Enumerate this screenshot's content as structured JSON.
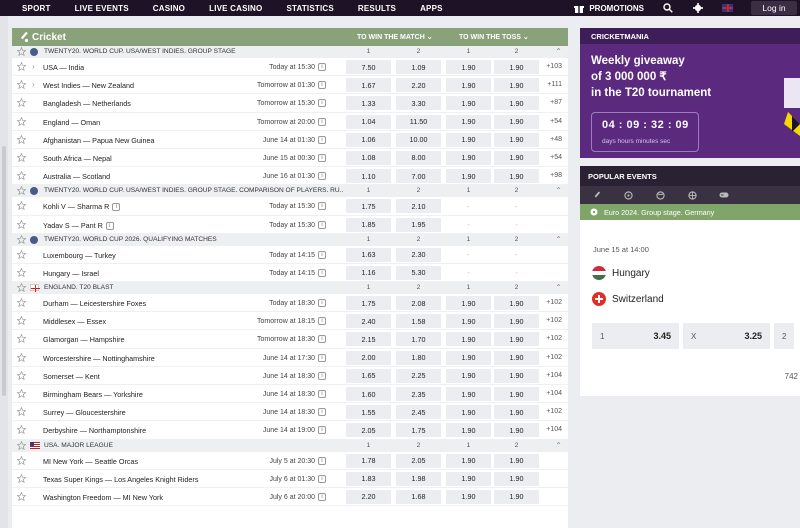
{
  "nav": {
    "items": [
      "SPORT",
      "LIVE EVENTS",
      "CASINO",
      "LIVE CASINO",
      "STATISTICS",
      "RESULTS",
      "APPS"
    ],
    "promotions": "PROMOTIONS",
    "login": "Log in"
  },
  "sport": {
    "title": "Cricket",
    "col_match": "TO WIN THE MATCH",
    "col_toss": "TO WIN THE TOSS"
  },
  "leagues": [
    {
      "name": "TWENTY20. WORLD CUP. USA/WEST INDIES. GROUP STAGE",
      "headers": [
        "1",
        "2",
        "1",
        "2"
      ],
      "rows": [
        {
          "teams": "USA — India",
          "time": "Today at 15:30",
          "odds": [
            "7.50",
            "1.09",
            "1.90",
            "1.90"
          ],
          "more": "+103",
          "chev": true
        },
        {
          "teams": "West Indies — New Zealand",
          "time": "Tomorrow at 01:30",
          "odds": [
            "1.67",
            "2.20",
            "1.90",
            "1.90"
          ],
          "more": "+111",
          "chev": true
        },
        {
          "teams": "Bangladesh — Netherlands",
          "time": "Tomorrow at 15:30",
          "odds": [
            "1.33",
            "3.30",
            "1.90",
            "1.90"
          ],
          "more": "+87"
        },
        {
          "teams": "England — Oman",
          "time": "Tomorrow at 20:00",
          "odds": [
            "1.04",
            "11.50",
            "1.90",
            "1.90"
          ],
          "more": "+54"
        },
        {
          "teams": "Afghanistan — Papua New Guinea",
          "time": "June 14 at 01:30",
          "odds": [
            "1.06",
            "10.00",
            "1.90",
            "1.90"
          ],
          "more": "+48"
        },
        {
          "teams": "South Africa — Nepal",
          "time": "June 15 at 00:30",
          "odds": [
            "1.08",
            "8.00",
            "1.90",
            "1.90"
          ],
          "more": "+54"
        },
        {
          "teams": "Australia — Scotland",
          "time": "June 16 at 01:30",
          "odds": [
            "1.10",
            "7.00",
            "1.90",
            "1.90"
          ],
          "more": "+98"
        }
      ]
    },
    {
      "name": "TWENTY20. WORLD CUP. USA/WEST INDIES. GROUP STAGE. COMPARISON OF PLAYERS. RU...",
      "headers": [
        "1",
        "2",
        "1",
        "2"
      ],
      "rows": [
        {
          "teams": "Kohli V — Sharma R",
          "time": "Today at 15:30",
          "odds": [
            "1.75",
            "2.10",
            "-",
            "-"
          ],
          "more": "",
          "info": true
        },
        {
          "teams": "Yadav S — Pant R",
          "time": "Today at 15:30",
          "odds": [
            "1.85",
            "1.95",
            "-",
            "-"
          ],
          "more": "",
          "info": true
        }
      ]
    },
    {
      "name": "TWENTY20. WORLD CUP 2026. QUALIFYING MATCHES",
      "headers": [
        "1",
        "2",
        "1",
        "2"
      ],
      "rows": [
        {
          "teams": "Luxembourg — Turkey",
          "time": "Today at 14:15",
          "odds": [
            "1.63",
            "2.30",
            "-",
            "-"
          ],
          "more": ""
        },
        {
          "teams": "Hungary — Israel",
          "time": "Today at 14:15",
          "odds": [
            "1.16",
            "5.30",
            "-",
            "-"
          ],
          "more": ""
        }
      ]
    },
    {
      "name": "ENGLAND. T20 BLAST",
      "headers": [
        "1",
        "2",
        "1",
        "2"
      ],
      "rows": [
        {
          "teams": "Durham — Leicestershire Foxes",
          "time": "Today at 18:30",
          "odds": [
            "1.75",
            "2.08",
            "1.90",
            "1.90"
          ],
          "more": "+102"
        },
        {
          "teams": "Middlesex — Essex",
          "time": "Tomorrow at 18:15",
          "odds": [
            "2.40",
            "1.58",
            "1.90",
            "1.90"
          ],
          "more": "+102"
        },
        {
          "teams": "Glamorgan — Hampshire",
          "time": "Tomorrow at 18:30",
          "odds": [
            "2.15",
            "1.70",
            "1.90",
            "1.90"
          ],
          "more": "+102"
        },
        {
          "teams": "Worcestershire — Nottinghamshire",
          "time": "June 14 at 17:30",
          "odds": [
            "2.00",
            "1.80",
            "1.90",
            "1.90"
          ],
          "more": "+102"
        },
        {
          "teams": "Somerset — Kent",
          "time": "June 14 at 18:30",
          "odds": [
            "1.65",
            "2.25",
            "1.90",
            "1.90"
          ],
          "more": "+104"
        },
        {
          "teams": "Birmingham Bears — Yorkshire",
          "time": "June 14 at 18:30",
          "odds": [
            "1.60",
            "2.35",
            "1.90",
            "1.90"
          ],
          "more": "+104"
        },
        {
          "teams": "Surrey — Gloucestershire",
          "time": "June 14 at 18:30",
          "odds": [
            "1.55",
            "2.45",
            "1.90",
            "1.90"
          ],
          "more": "+102"
        },
        {
          "teams": "Derbyshire — Northamptonshire",
          "time": "June 14 at 19:00",
          "odds": [
            "2.05",
            "1.75",
            "1.90",
            "1.90"
          ],
          "more": "+104"
        }
      ]
    },
    {
      "name": "USA. MAJOR LEAGUE",
      "headers": [
        "1",
        "2",
        "1",
        "2"
      ],
      "rows": [
        {
          "teams": "MI New York — Seattle Orcas",
          "time": "July 5 at 20:30",
          "odds": [
            "1.78",
            "2.05",
            "1.90",
            "1.90"
          ],
          "more": ""
        },
        {
          "teams": "Texas Super Kings — Los Angeles Knight Riders",
          "time": "July 6 at 01:30",
          "odds": [
            "1.83",
            "1.98",
            "1.90",
            "1.90"
          ],
          "more": ""
        },
        {
          "teams": "Washington Freedom — MI New York",
          "time": "July 6 at 20:00",
          "odds": [
            "2.20",
            "1.68",
            "1.90",
            "1.90"
          ],
          "more": ""
        }
      ]
    }
  ],
  "promo": {
    "head": "CRICKETMANIA",
    "line1": "Weekly giveaway",
    "line2": "of 3 000 000 ₹",
    "line3": "in the T20 tournament",
    "timer": "04 : 09 : 32 : 09",
    "units": "days   hours minutes   sec"
  },
  "popular": {
    "head": "POPULAR EVENTS",
    "league": "Euro 2024. Group stage. Germany",
    "date": "June 15 at 14:00",
    "team1": "Hungary",
    "team2": "Switzerland",
    "odds": [
      {
        "k": "1",
        "v": "3.45"
      },
      {
        "k": "X",
        "v": "3.25"
      },
      {
        "k": "2",
        "v": ""
      }
    ],
    "footer": "742"
  },
  "colors": {
    "nav_bg": "#1e1326",
    "sport_head": "#8aa27a",
    "promo_bg": "#5b2a7f",
    "popular_green": "#7fa56a"
  }
}
